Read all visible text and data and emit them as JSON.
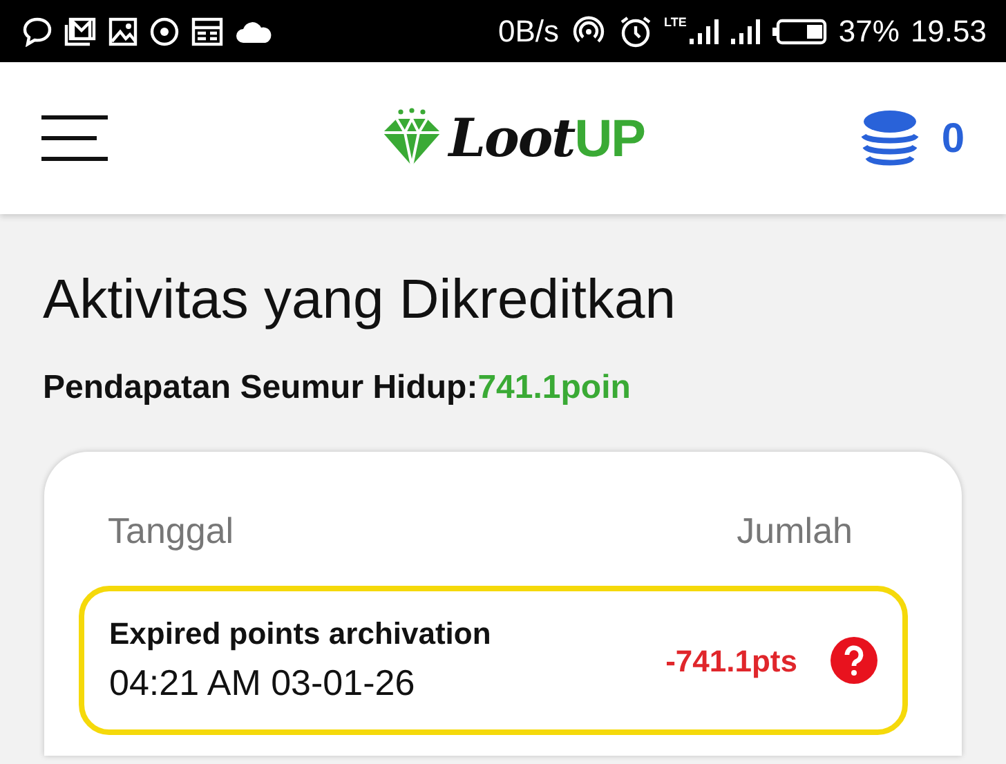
{
  "status_bar": {
    "speed": "0B/s",
    "network": "LTE",
    "battery": "37%",
    "time": "19.53"
  },
  "header": {
    "logo_parts": [
      "Loot",
      "UP"
    ],
    "coins": "0"
  },
  "page": {
    "title": "Aktivitas yang Dikreditkan",
    "lifetime_label": "Pendapatan Seumur Hidup:",
    "lifetime_value": "741.1poin"
  },
  "table": {
    "columns": [
      "Tanggal",
      "Jumlah"
    ],
    "rows": [
      {
        "title": "Expired points archivation",
        "datetime": "04:21 AM 03-01-26",
        "amount": "-741.1pts"
      }
    ]
  }
}
